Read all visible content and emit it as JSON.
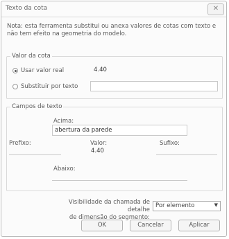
{
  "window": {
    "title": "Texto da cota",
    "close_glyph": "✕"
  },
  "note": "Nota: esta ferramenta substitui ou anexa valores de cotas com texto e não tem efeito na geometria do modelo.",
  "dimension_value": {
    "group_title": "Valor da cota",
    "use_actual_label": "Usar valor real",
    "use_actual_value": "4.40",
    "use_actual_selected": true,
    "replace_label": "Substituir por texto",
    "replace_value": ""
  },
  "text_fields": {
    "group_title": "Campos de texto",
    "above_label": "Acima:",
    "above_value": "abertura da parede",
    "prefix_label": "Prefixo:",
    "prefix_value": "",
    "value_label": "Valor:",
    "value_value": "4.40",
    "suffix_label": "Sufixo:",
    "suffix_value": "",
    "below_label": "Abaixo:",
    "below_value": ""
  },
  "visibility": {
    "label_line1": "Visibilidade da chamada de detalhe",
    "label_line2": "de dimensão do segmento:",
    "selected_option": "Por elemento"
  },
  "buttons": {
    "ok": "OK",
    "cancel": "Cancelar",
    "apply": "Aplicar"
  },
  "icons": {
    "dropdown": "chevron-down-icon",
    "close": "close-icon"
  }
}
